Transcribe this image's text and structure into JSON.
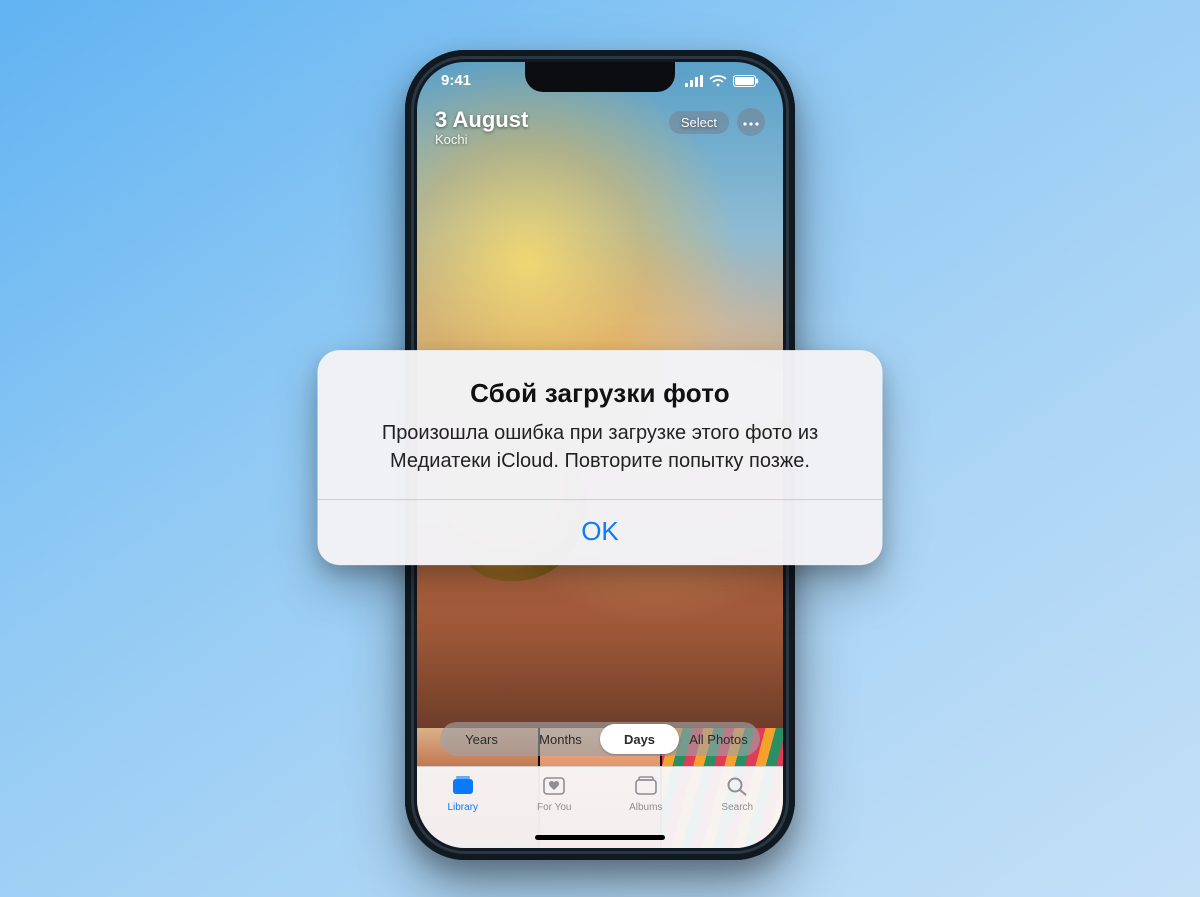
{
  "status": {
    "time": "9:41"
  },
  "header": {
    "date": "3 August",
    "location": "Kochi",
    "select_label": "Select"
  },
  "segmented": {
    "items": [
      "Years",
      "Months",
      "Days",
      "All Photos"
    ],
    "active_index": 2
  },
  "tabs": {
    "items": [
      {
        "label": "Library"
      },
      {
        "label": "For You"
      },
      {
        "label": "Albums"
      },
      {
        "label": "Search"
      }
    ],
    "active_index": 0
  },
  "alert": {
    "title": "Сбой загрузки фото",
    "message": "Произошла ошибка при загрузке этого фото из Медиатеки iCloud. Повторите попытку позже.",
    "ok_label": "OK"
  },
  "colors": {
    "accent": "#0a7aff"
  }
}
